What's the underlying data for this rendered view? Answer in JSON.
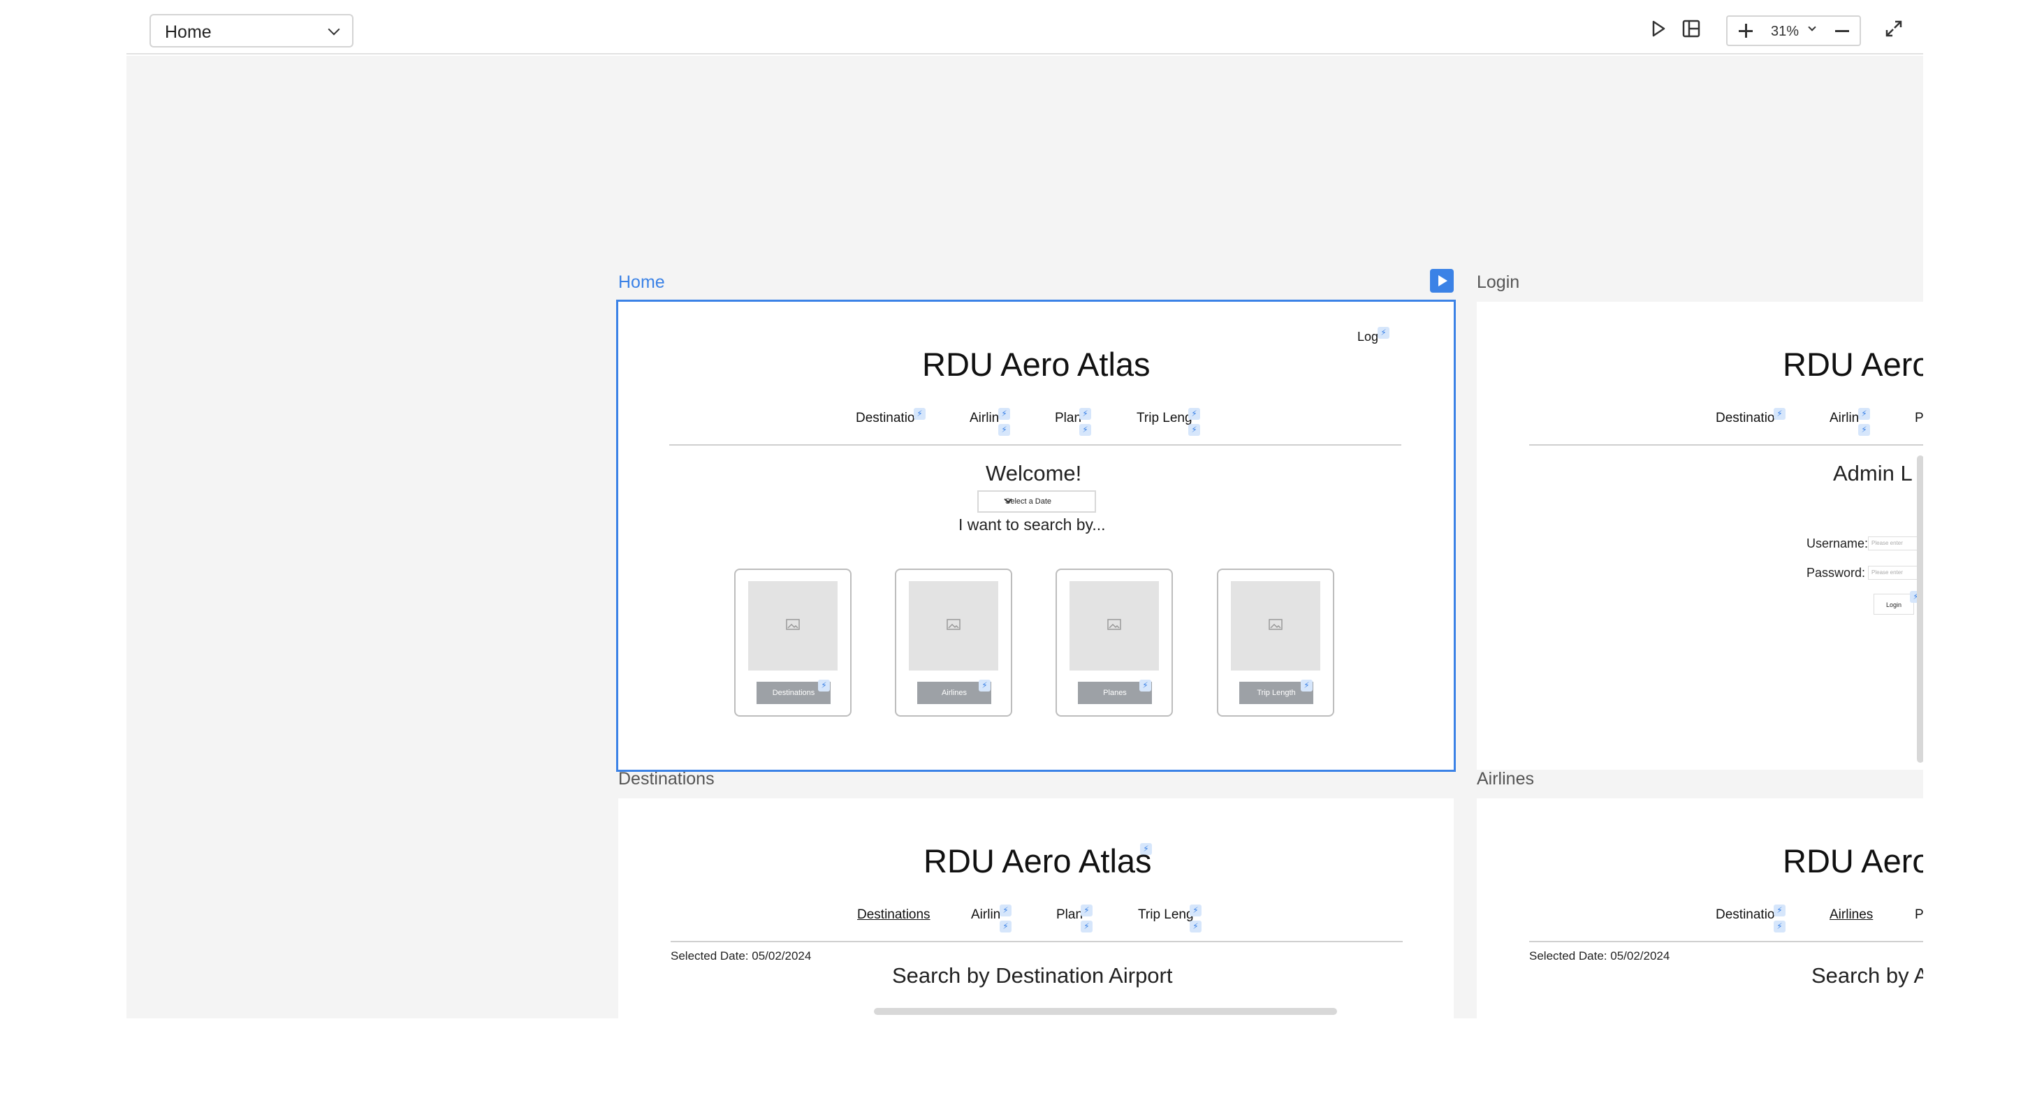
{
  "toolbar": {
    "page_select_value": "Home",
    "zoom_level": "31%"
  },
  "frames": {
    "home": {
      "label": "Home",
      "title": "RDU Aero Atlas",
      "login_link": "Log",
      "nav": [
        "Destinatio",
        "Airlin",
        "Plan",
        "Trip Leng"
      ],
      "welcome": "Welcome!",
      "date_select": "Select a Date",
      "search_prompt": "I want to search by...",
      "cards": [
        "Destinations",
        "Airlines",
        "Planes",
        "Trip Length"
      ]
    },
    "login": {
      "label": "Login",
      "title": "RDU Aero",
      "nav": [
        "Destinatio",
        "Airlin",
        "P"
      ],
      "heading": "Admin L",
      "username_label": "Username:",
      "password_label": "Password:",
      "username_placeholder": "Please enter",
      "password_placeholder": "Please enter",
      "login_button": "Login"
    },
    "destinations": {
      "label": "Destinations",
      "title": "RDU Aero Atlas",
      "nav": [
        "Destinations",
        "Airlin",
        "Plan",
        "Trip Leng"
      ],
      "selected_date": "Selected Date: 05/02/2024",
      "heading": "Search by Destination Airport"
    },
    "airlines": {
      "label": "Airlines",
      "title": "RDU Aero",
      "nav": [
        "Destinatio",
        "Airlines",
        "P"
      ],
      "selected_date": "Selected Date: 05/02/2024",
      "heading": "Search by A"
    }
  },
  "colors": {
    "accent": "#3b82e6",
    "canvas": "#f4f4f4",
    "card_button": "#9da1a6"
  }
}
